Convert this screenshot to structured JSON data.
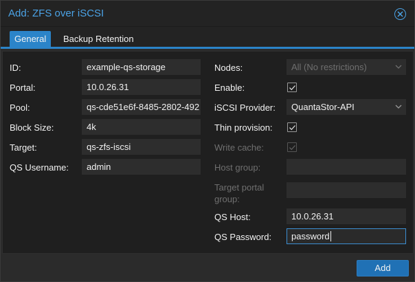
{
  "dialog": {
    "title": "Add: ZFS over iSCSI"
  },
  "tabs": [
    {
      "label": "General",
      "active": true
    },
    {
      "label": "Backup Retention",
      "active": false
    }
  ],
  "left": {
    "id": {
      "label": "ID:",
      "value": "example-qs-storage"
    },
    "portal": {
      "label": "Portal:",
      "value": "10.0.26.31"
    },
    "pool": {
      "label": "Pool:",
      "value": "qs-cde51e6f-8485-2802-492"
    },
    "block_size": {
      "label": "Block Size:",
      "value": "4k"
    },
    "target": {
      "label": "Target:",
      "value": "qs-zfs-iscsi"
    },
    "qs_username": {
      "label": "QS Username:",
      "value": "admin"
    }
  },
  "right": {
    "nodes": {
      "label": "Nodes:",
      "value": "All (No restrictions)"
    },
    "enable": {
      "label": "Enable:",
      "checked": true
    },
    "iscsi_provider": {
      "label": "iSCSI Provider:",
      "value": "QuantaStor-API"
    },
    "thin_provision": {
      "label": "Thin provision:",
      "checked": true
    },
    "write_cache": {
      "label": "Write cache:",
      "checked": true,
      "disabled": true
    },
    "host_group": {
      "label": "Host group:",
      "value": ""
    },
    "target_portal_group": {
      "label_line1": "Target portal",
      "label_line2": "group:",
      "value": ""
    },
    "qs_host": {
      "label": "QS Host:",
      "value": "10.0.26.31"
    },
    "qs_password": {
      "label": "QS Password:",
      "value": "password"
    }
  },
  "footer": {
    "add_label": "Add"
  },
  "colors": {
    "accent": "#2b84c9",
    "title": "#4ba3e6",
    "button": "#2071b5"
  }
}
